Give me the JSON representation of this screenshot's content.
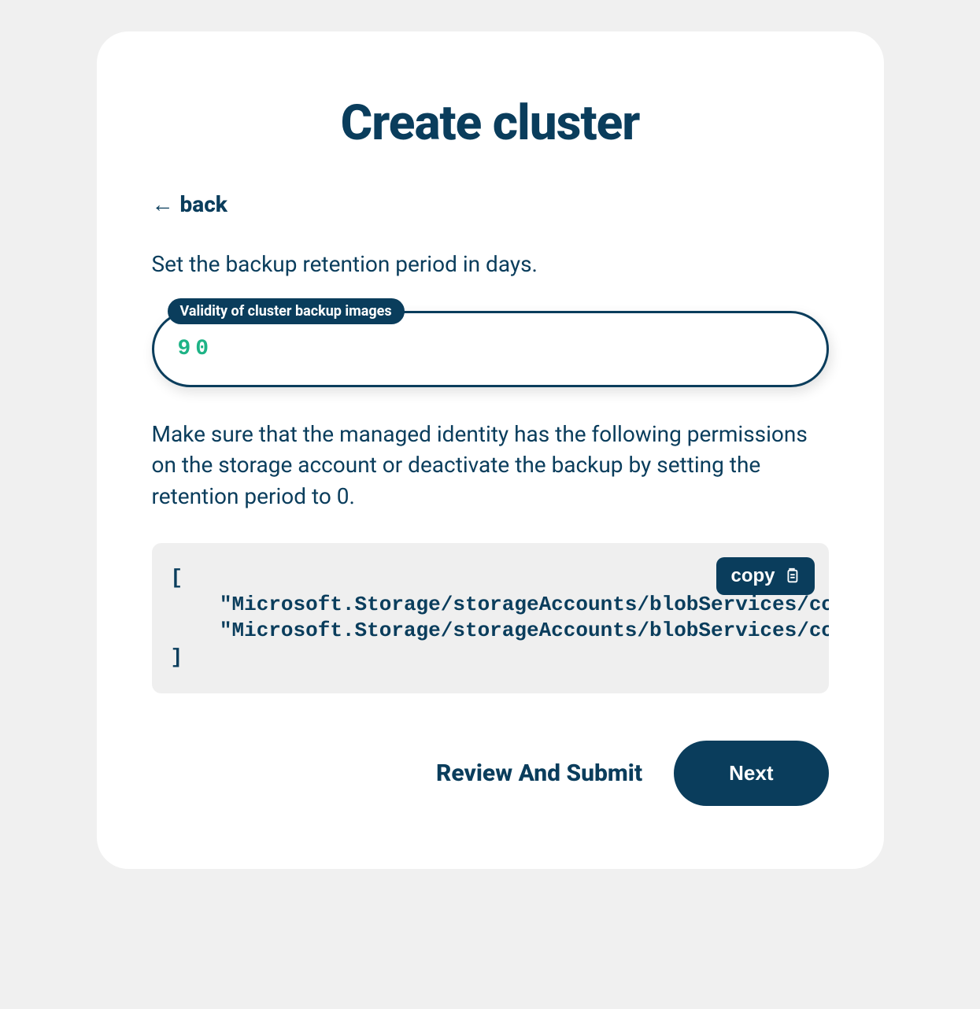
{
  "header": {
    "title": "Create cluster",
    "back_label": "back"
  },
  "form": {
    "description1": "Set the backup retention period in days.",
    "input_label": "Validity of cluster backup images",
    "input_value": "90",
    "description2": "Make sure that the managed identity has the following permissions on the storage account or deactivate the backup by setting the retention period to 0.",
    "code_content": "[\n    \"Microsoft.Storage/storageAccounts/blobServices/containers/read\",\n    \"Microsoft.Storage/storageAccounts/blobServices/containers/write\"\n]",
    "copy_label": "copy"
  },
  "footer": {
    "review_label": "Review And Submit",
    "next_label": "Next"
  }
}
